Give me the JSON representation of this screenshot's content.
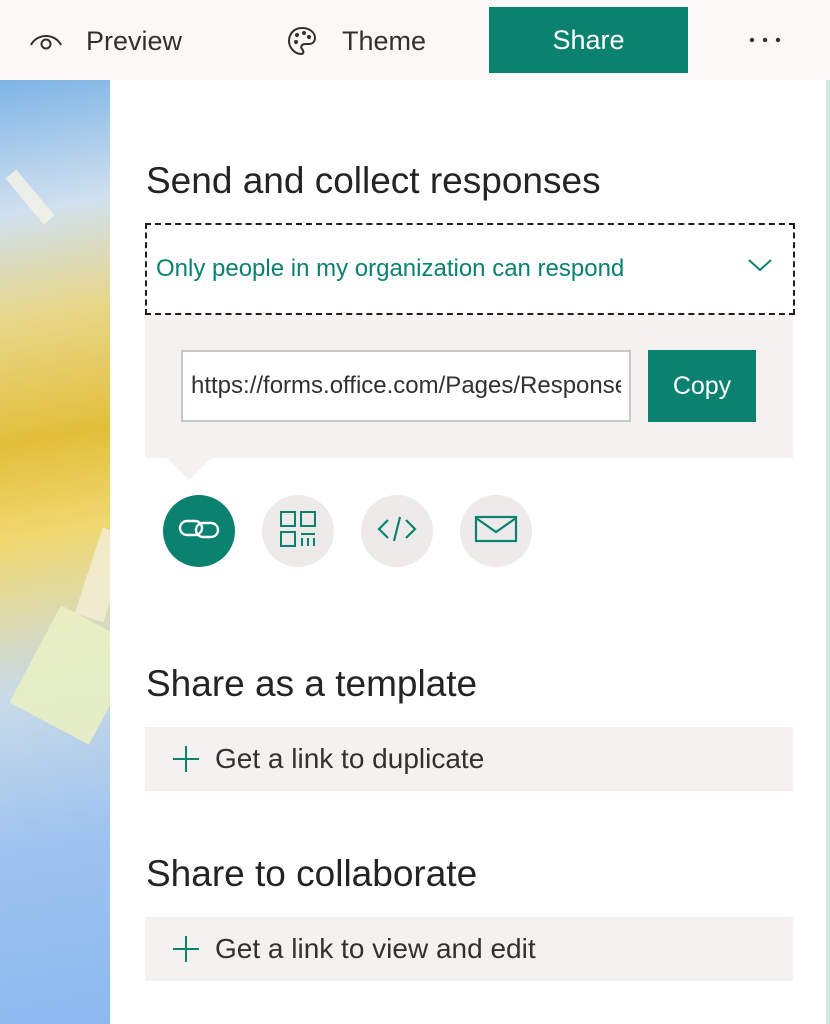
{
  "topbar": {
    "preview_label": "Preview",
    "theme_label": "Theme",
    "share_label": "Share",
    "more_label": "···"
  },
  "panel": {
    "send_heading": "Send and collect responses",
    "permission": {
      "selected": "Only people in my organization can respond"
    },
    "link": {
      "value": "https://forms.office.com/Pages/ResponsePage.aspx",
      "copy_label": "Copy"
    },
    "share_options": [
      "link-icon",
      "qr-code-icon",
      "embed-code-icon",
      "email-icon"
    ],
    "template_heading": "Share as a template",
    "template_action": "Get a link to duplicate",
    "collab_heading": "Share to collaborate",
    "collab_action": "Get a link to view and edit"
  },
  "colors": {
    "accent": "#0b8270",
    "panel_bg": "#ffffff",
    "row_bg": "#f3f2f1"
  }
}
